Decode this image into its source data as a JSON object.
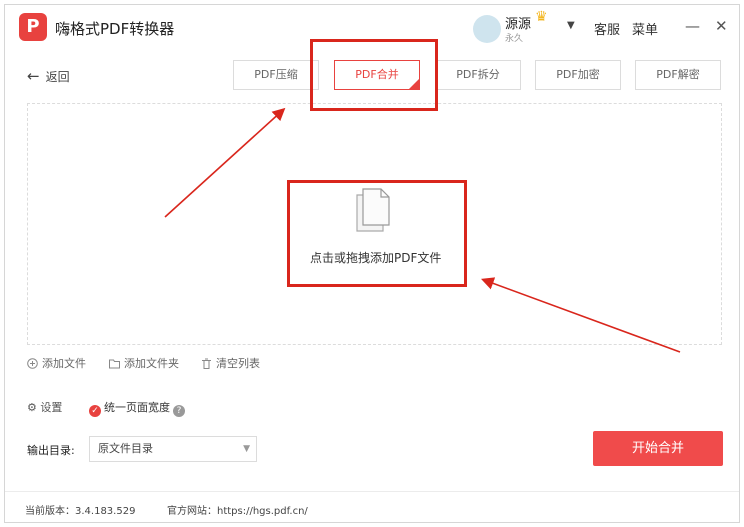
{
  "app": {
    "title": "嗨格式PDF转换器",
    "logo_letter": "P",
    "user_name": "源源",
    "user_sub": "永久",
    "links": {
      "service": "客服",
      "menu": "菜单"
    },
    "window": {
      "minimize": "—",
      "close": "✕"
    }
  },
  "nav": {
    "back_label": "返回"
  },
  "tabs": [
    {
      "label": "PDF压缩",
      "active": false
    },
    {
      "label": "PDF合并",
      "active": true
    },
    {
      "label": "PDF拆分",
      "active": false
    },
    {
      "label": "PDF加密",
      "active": false
    },
    {
      "label": "PDF解密",
      "active": false
    }
  ],
  "dropzone": {
    "text": "点击或拖拽添加PDF文件"
  },
  "actions": {
    "add_file": "添加文件",
    "add_folder": "添加文件夹",
    "clear_list": "清空列表"
  },
  "options": {
    "settings": "设置",
    "unify_width": "统一页面宽度",
    "help": "?"
  },
  "output": {
    "label": "输出目录:",
    "value": "原文件目录"
  },
  "start_button": "开始合并",
  "footer": {
    "version": "当前版本：3.4.183.529",
    "website": "官方网站：https://hgs.pdf.cn/"
  },
  "colors": {
    "accent": "#e8423f",
    "annotation": "#d9261c",
    "start_button": "#f04b4b"
  }
}
